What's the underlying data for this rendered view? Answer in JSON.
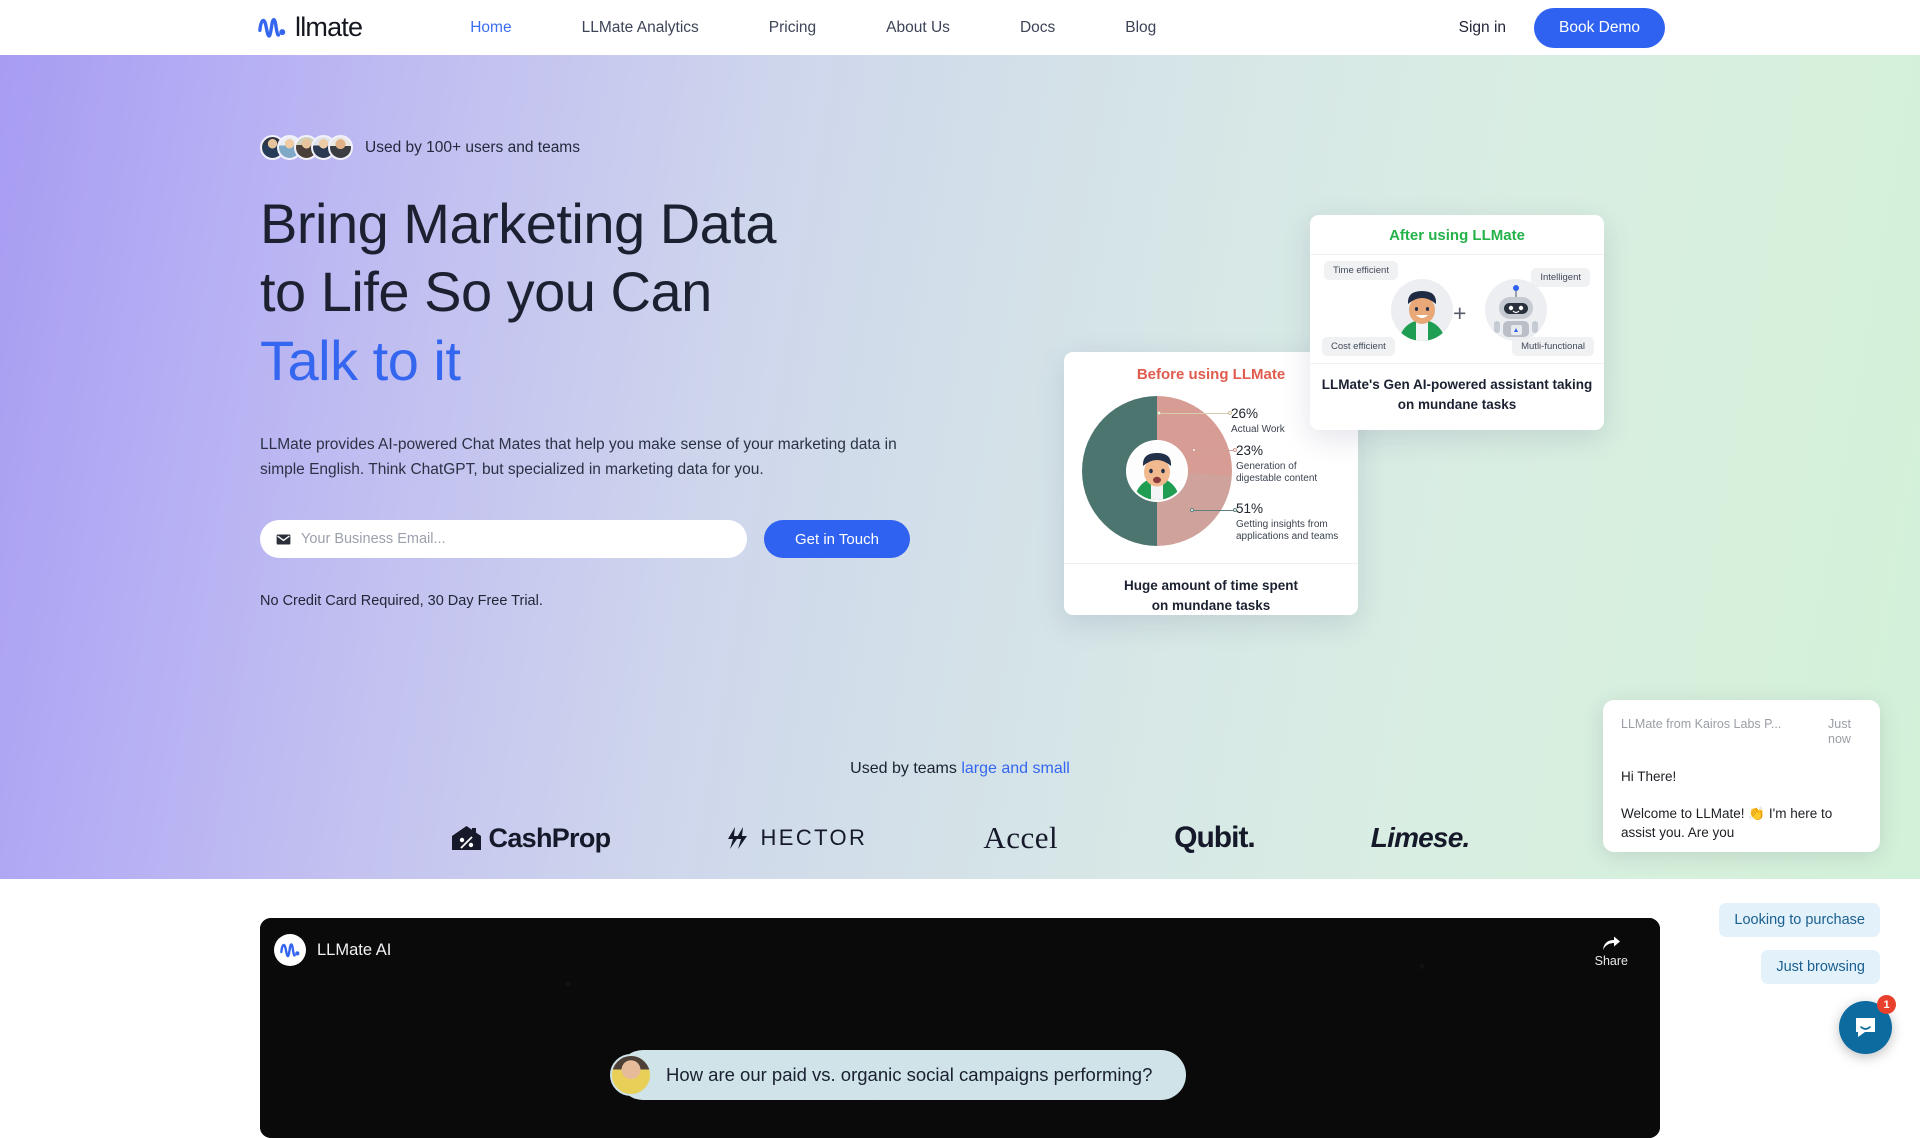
{
  "navbar": {
    "brand": "llmate",
    "brand_icon": "llmate-wave-logo",
    "links": [
      {
        "label": "Home",
        "active": true
      },
      {
        "label": "LLMate Analytics",
        "active": false
      },
      {
        "label": "Pricing",
        "active": false
      },
      {
        "label": "About Us",
        "active": false
      },
      {
        "label": "Docs",
        "active": false
      },
      {
        "label": "Blog",
        "active": false
      }
    ],
    "signin_label": "Sign in",
    "book_demo_label": "Book Demo",
    "accent_color": "#2f62f0"
  },
  "hero": {
    "social_proof_text": "Used by 100+ users and teams",
    "avatar_count": 5,
    "title_line1": "Bring Marketing Data",
    "title_line2": "to Life So you Can",
    "title_accent": "Talk to it",
    "accent_color": "#3566ef",
    "subtitle": "LLMate provides AI-powered Chat Mates that help you make sense of your marketing data in simple English. Think ChatGPT, but specialized in marketing data for you.",
    "email_placeholder": "Your Business Email...",
    "email_value": "",
    "cta_label": "Get in Touch",
    "fineprint": "No Credit Card Required, 30 Day Free Trial."
  },
  "before_card": {
    "title": "Before using LLMate",
    "title_color": "#e05c4e",
    "caption_line1": "Huge amount of time spent",
    "caption_line2": "on mundane tasks"
  },
  "after_card": {
    "title": "After using LLMate",
    "title_color": "#24b24a",
    "chips": {
      "time": "Time efficient",
      "cost": "Cost efficient",
      "intelligent": "Intelligent",
      "multi": "Mutli-functional"
    },
    "plus": "+",
    "caption_line1": "LLMate's Gen AI-powered assistant taking",
    "caption_line2": "on mundane tasks"
  },
  "chart_data": {
    "type": "pie",
    "title": "Before using LLMate",
    "categories": [
      "Actual Work",
      "Generation of digestable content",
      "Getting insights from applications and teams"
    ],
    "values": [
      26,
      23,
      51
    ],
    "value_labels": [
      "26%",
      "23%",
      "51%"
    ],
    "colors": [
      "#e2ddb9",
      "#d79d94",
      "#4d7570"
    ],
    "unit": "%",
    "donut": true,
    "legend": "callout-labels",
    "labels": [
      {
        "pct": "26%",
        "name": "Actual Work"
      },
      {
        "pct": "23%",
        "name_line1": "Generation of",
        "name_line2": "digestable content"
      },
      {
        "pct": "51%",
        "name_line1": "Getting insights from",
        "name_line2": "applications and teams"
      }
    ]
  },
  "teams": {
    "prefix": "Used by teams ",
    "link": "large and small",
    "logos": [
      {
        "name": "CashProp",
        "icon": "house-percent-icon"
      },
      {
        "name": "HECTOR",
        "icon": "lightning-h-icon"
      },
      {
        "name": "Accel",
        "icon": ""
      },
      {
        "name": "Qubit.",
        "icon": ""
      },
      {
        "name": "Limese.",
        "icon": ""
      }
    ]
  },
  "video": {
    "brand": "LLMate AI",
    "share_label": "Share",
    "chat_message": "How are our paid vs. organic social campaigns performing?"
  },
  "intercom": {
    "from": "LLMate from Kairos Labs P...",
    "separator": "•",
    "time": "Just now",
    "greeting": "Hi There!",
    "message": "Welcome to LLMate! 👏 I'm here to assist you. Are you",
    "replies": [
      "Looking to purchase",
      "Just browsing"
    ],
    "badge_count": "1",
    "launcher_color": "#0e6ba0"
  }
}
